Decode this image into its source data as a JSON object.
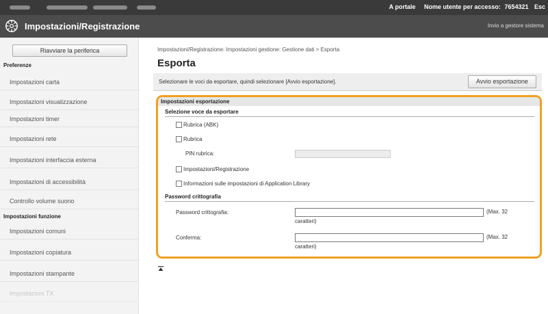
{
  "header": {
    "portal_link": "A portale",
    "user_label": "Nome utente per accesso:",
    "user_value": "7654321",
    "logout": "Esc"
  },
  "titlebar": {
    "title": "Impostazioni/Registrazione",
    "link": "Invio a gestore sistema"
  },
  "sidebar": {
    "restart_button": "Riavviare la periferica",
    "section_preferences": "Preferenze",
    "preferences": [
      "Impostazioni carta",
      "Impostazioni visualizzazione",
      "Impostazioni timer",
      "Impostazioni rete",
      "Impostazioni interfaccia esterna",
      "Impostazioni di accessibilità",
      "Controllo volume suono"
    ],
    "section_functions": "Impostazioni funzione",
    "functions": [
      "Impostazioni comuni",
      "Impostazioni copiatura",
      "Impostazioni stampante",
      "Impostazioni TX"
    ]
  },
  "main": {
    "breadcrumb": "Impostazioni/Registrazione: Impostazioni gestione: Gestione dati > Esporta",
    "title": "Esporta",
    "instruction": "Selezionare le voci da esportare, quindi selezionare [Avvio esportazione].",
    "start_button": "Avvio esportazione",
    "export_settings": {
      "header": "Impostazioni esportazione",
      "select_heading": "Selezione voce da esportare",
      "items": {
        "address_book_abk": "Rubrica (ABK)",
        "address_book": "Rubrica",
        "pin_label": "PIN rubrica:",
        "settings_registration": "Impostazioni/Registrazione",
        "app_library": "Informazioni sulle impostazioni di Application Library"
      },
      "password_heading": "Password crittografia",
      "password_label": "Password crittografia:",
      "confirm_label": "Conferma:",
      "max_note_1": "(Max. 32",
      "max_note_2": "caratteri)"
    }
  },
  "colors": {
    "highlight": "#f0a020",
    "header_bg": "#4c4c4c",
    "topbar_bg": "#3a3a3a"
  }
}
